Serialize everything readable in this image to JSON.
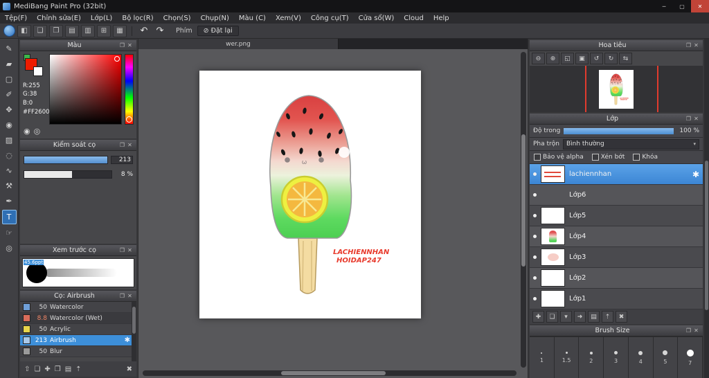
{
  "titlebar": {
    "title": "MediBang Paint Pro (32bit)",
    "minimize": "─",
    "maximize": "▢",
    "close": "✕"
  },
  "menu": {
    "items": [
      "Tệp(F)",
      "Chỉnh sửa(E)",
      "Lớp(L)",
      "Bộ lọc(R)",
      "Chọn(S)",
      "Chụp(N)",
      "Màu (C)",
      "Xem(V)",
      "Công cụ(T)",
      "Cửa sổ(W)",
      "Cloud",
      "Help"
    ]
  },
  "toolbar": {
    "icons": [
      "◧",
      "❑",
      "❒",
      "▤",
      "▥",
      "⊞",
      "▦"
    ],
    "undo": "↶",
    "redo": "↷",
    "key_label": "Phím",
    "reset_icon": "⊘",
    "reset_label": "Đặt lại"
  },
  "toolstrip": {
    "tools": [
      "✎",
      "▰",
      "▢",
      "✐",
      "✥",
      "◉",
      "▨",
      "◌",
      "∿",
      "⚒",
      "✒",
      "T",
      "☞",
      "◎"
    ]
  },
  "panel_icons": {
    "detach": "❐",
    "close": "✕"
  },
  "panels": {
    "color": {
      "title": "Màu",
      "r": "R:255",
      "g": "G:38",
      "b": "B:0",
      "hex": "#FF2600",
      "fg_color": "#ee1c00",
      "accent_color": "#3cb54a",
      "wheel_icons": [
        "◉",
        "◎"
      ]
    },
    "brush_control": {
      "title": "Kiểm soát cọ",
      "slider1_value": "213",
      "slider2_value": "8 %"
    },
    "brush_preview": {
      "title": "Xem trước cọ",
      "size_label": "45.6ppt"
    },
    "brush_list": {
      "title": "Cọ: Airbrush",
      "gear_icon": "✱",
      "brushes": [
        {
          "size": "50",
          "name": "Watercolor"
        },
        {
          "size": "8.8",
          "name": "Watercolor (Wet)"
        },
        {
          "size": "50",
          "name": "Acrylic"
        },
        {
          "size": "213",
          "name": "Airbrush"
        },
        {
          "size": "50",
          "name": "Blur"
        }
      ]
    }
  },
  "left_bottom_icons": [
    "⇧",
    "❏",
    "✚",
    "❐",
    "▤",
    "⇡",
    "✖"
  ],
  "canvas": {
    "tab": "wer.png",
    "signature": [
      "LACHIENNHAN",
      "HOIDAP247"
    ],
    "mouth": "ω"
  },
  "navigator": {
    "title": "Hoa tiêu",
    "icons": [
      "⊖",
      "⊕",
      "◱",
      "▣",
      "↺",
      "↻",
      "⇆"
    ]
  },
  "layers": {
    "title": "Lớp",
    "opacity_label": "Độ trong",
    "opacity_value": "100 %",
    "blend_label": "Pha trộn",
    "blend_value": "Bình thường",
    "blend_arrow": "▾",
    "alpha_label": "Bảo vệ alpha",
    "clip_label": "Xén bớt",
    "lock_label": "Khóa",
    "gear_icon": "✱",
    "items": [
      {
        "name": "lachiennhan"
      },
      {
        "name": "Lớp6"
      },
      {
        "name": "Lớp5"
      },
      {
        "name": "Lớp4"
      },
      {
        "name": "Lớp3"
      },
      {
        "name": "Lớp2"
      },
      {
        "name": "Lớp1"
      }
    ],
    "toolbar_icons": [
      "✚",
      "❏",
      "▾",
      "➜",
      "▤",
      "⇡",
      "✖"
    ]
  },
  "brush_size": {
    "title": "Brush Size",
    "sizes": [
      "1",
      "1.5",
      "2",
      "3",
      "4",
      "5",
      "7"
    ]
  }
}
